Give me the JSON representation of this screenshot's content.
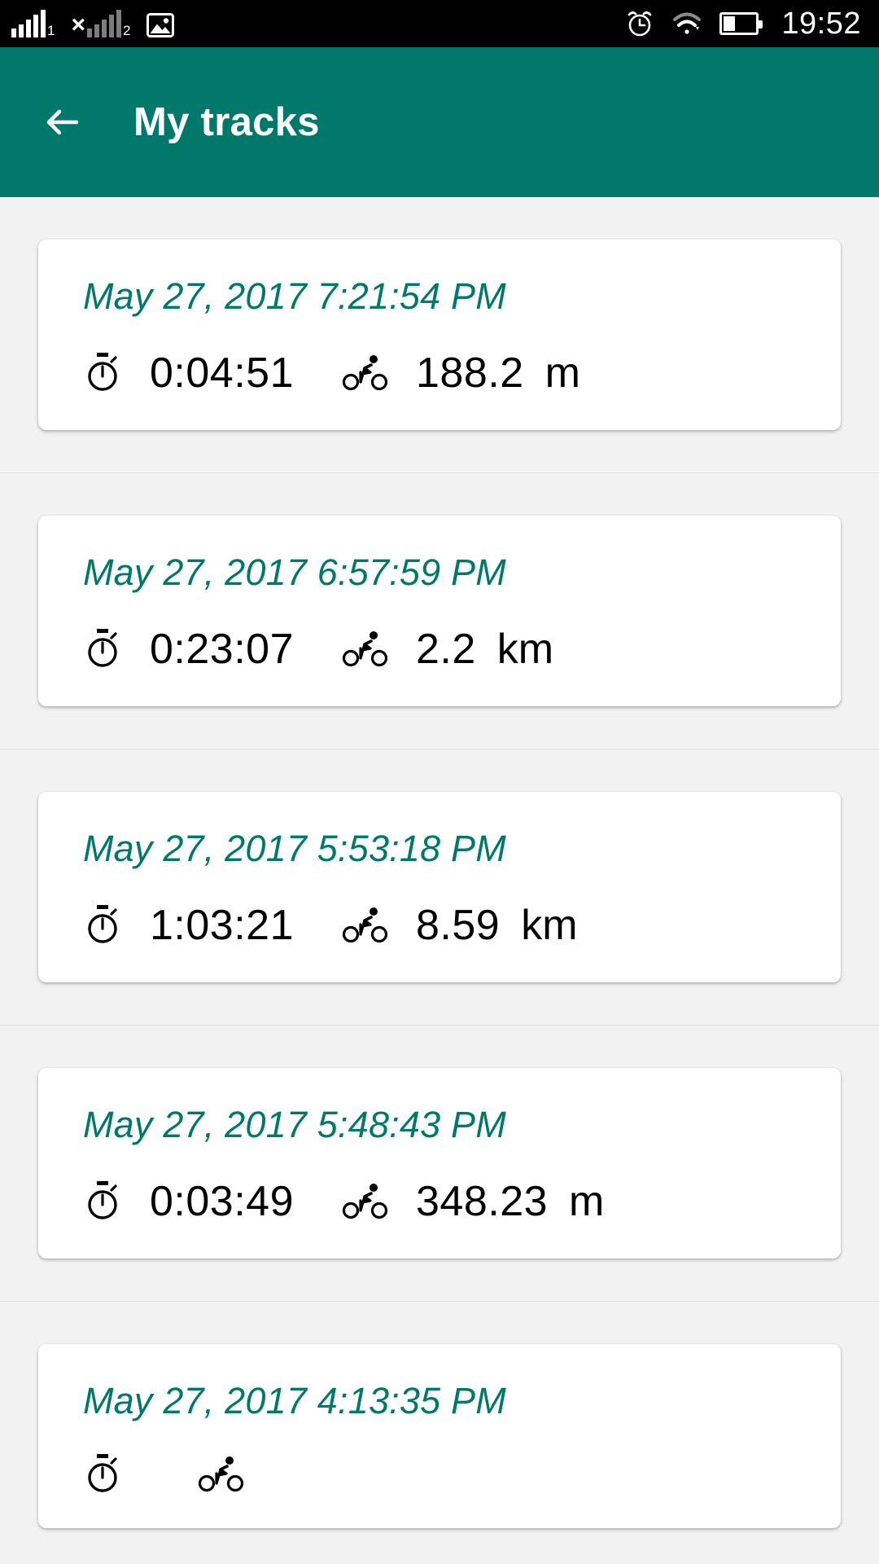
{
  "status_bar": {
    "sim1_label": "1",
    "sim2_label": "2",
    "sim2_x": "×",
    "icons": [
      "signal-sim1-icon",
      "signal-sim2-icon",
      "photo-icon",
      "alarm-icon",
      "wifi-icon",
      "battery-icon"
    ],
    "clock": "19:52",
    "battery_level": "36%"
  },
  "app_bar": {
    "title": "My tracks",
    "back_icon": "back-arrow-icon",
    "background_color": "#00796b"
  },
  "theme": {
    "accent": "#00796b",
    "page_background": "#f2f2f2",
    "card_background": "#ffffff",
    "text_color": "#000000"
  },
  "tracks": [
    {
      "date": "May 27, 2017 7:21:54 PM",
      "duration": "0:04:51",
      "distance": "188.2",
      "unit": "m",
      "duration_icon": "stopwatch-icon",
      "distance_icon": "bicycle-icon"
    },
    {
      "date": "May 27, 2017 6:57:59 PM",
      "duration": "0:23:07",
      "distance": "2.2",
      "unit": "km",
      "duration_icon": "stopwatch-icon",
      "distance_icon": "bicycle-icon"
    },
    {
      "date": "May 27, 2017 5:53:18 PM",
      "duration": "1:03:21",
      "distance": "8.59",
      "unit": "km",
      "duration_icon": "stopwatch-icon",
      "distance_icon": "bicycle-icon"
    },
    {
      "date": "May 27, 2017 5:48:43 PM",
      "duration": "0:03:49",
      "distance": "348.23",
      "unit": "m",
      "duration_icon": "stopwatch-icon",
      "distance_icon": "bicycle-icon"
    },
    {
      "date": "May 27, 2017 4:13:35 PM",
      "duration": "",
      "distance": "",
      "unit": "",
      "duration_icon": "stopwatch-icon",
      "distance_icon": "bicycle-icon"
    }
  ]
}
